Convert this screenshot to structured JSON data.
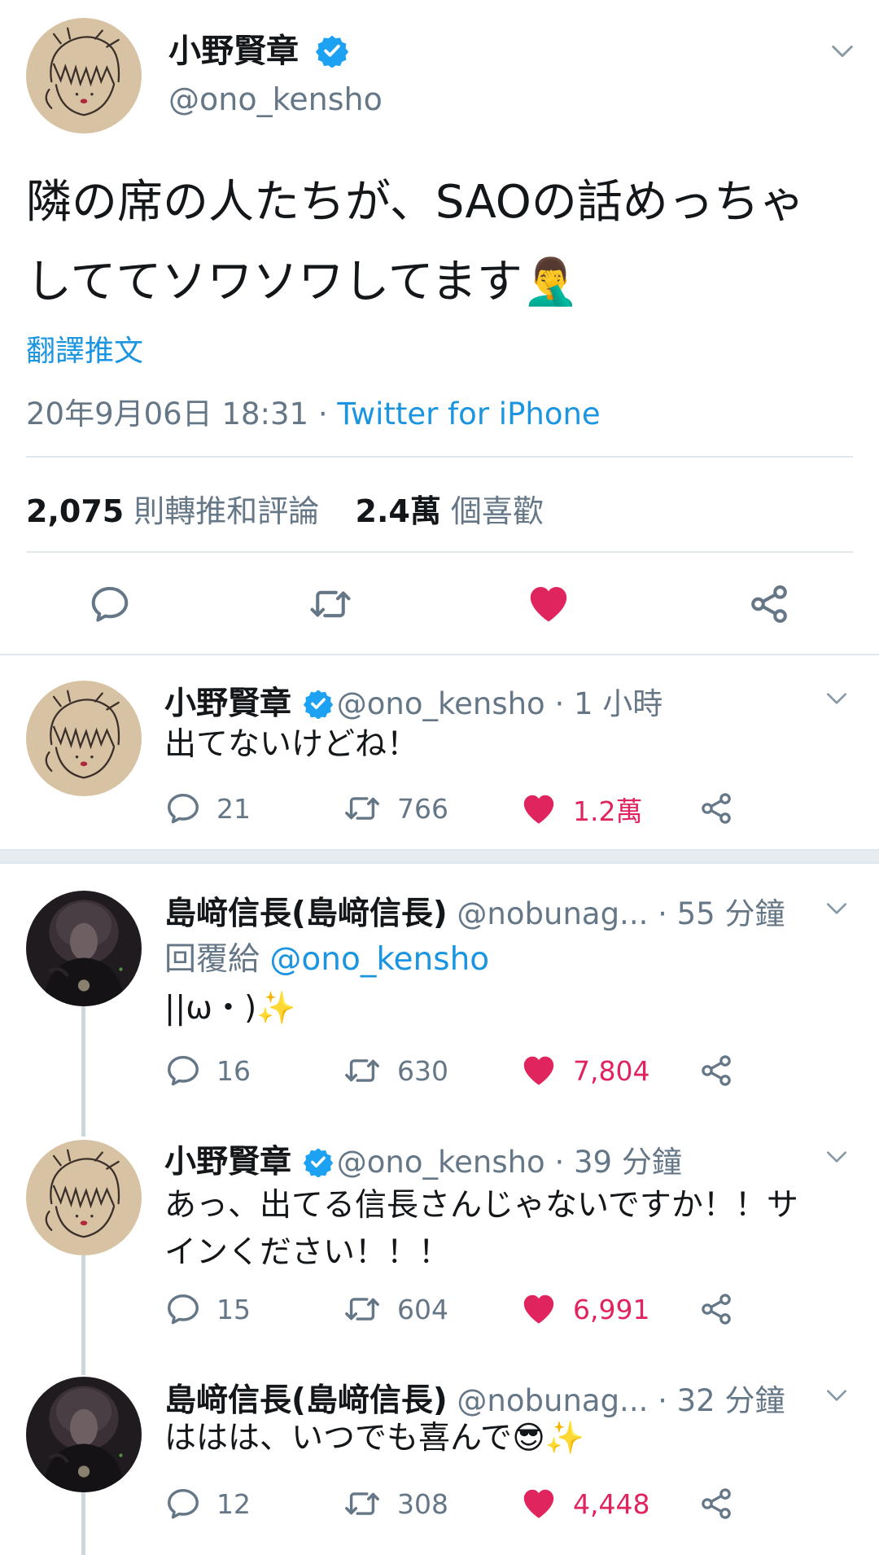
{
  "main_tweet": {
    "name": "小野賢章",
    "handle": "@ono_kensho",
    "text_line1": "隣の席の人たちが、SAOの話めっちゃ",
    "text_line2": "しててソワソワしてます",
    "emoji": "🤦‍♂️",
    "translate_label": "翻譯推文",
    "timestamp": "20年9月06日 18:31",
    "separator": " · ",
    "source": "Twitter for iPhone",
    "retweets_comments_count": "2,075",
    "retweets_comments_label": "則轉推和評論",
    "likes_count": "2.4萬",
    "likes_label": "個喜歡"
  },
  "replies": [
    {
      "name": "小野賢章",
      "verified": true,
      "handle": "@ono_kensho",
      "time": "· 1 小時",
      "text_lines": [
        "出てないけどね！"
      ],
      "replies": "21",
      "retweets": "766",
      "likes": "1.2萬"
    },
    {
      "name": "島﨑信長(島﨑信長)",
      "verified": false,
      "handle": "@nobunag...",
      "time": "· 55 分鐘",
      "reply_to_label": "回覆給",
      "reply_to_handle": "@ono_kensho",
      "text_lines": [
        "||ω・)"
      ],
      "emoji": "✨",
      "replies": "16",
      "retweets": "630",
      "likes": "7,804"
    },
    {
      "name": "小野賢章",
      "verified": true,
      "handle": "@ono_kensho",
      "time": "· 39 分鐘",
      "text_lines": [
        "あっ、出てる信長さんじゃないですか！！サ",
        "インください！！！"
      ],
      "replies": "15",
      "retweets": "604",
      "likes": "6,991"
    },
    {
      "name": "島﨑信長(島﨑信長)",
      "verified": false,
      "handle": "@nobunag...",
      "time": "· 32 分鐘",
      "text_lines": [
        "ははは、いつでも喜んで"
      ],
      "emoji": "😎✨",
      "replies": "12",
      "retweets": "308",
      "likes": "4,448"
    }
  ],
  "colors": {
    "text": "#14171a",
    "secondary": "#657786",
    "link": "#1b95e0",
    "like": "#e0245e",
    "divider": "#e1e8ed",
    "verified": "#1da1f2"
  },
  "icons": [
    "reply-icon",
    "retweet-icon",
    "heart-icon",
    "share-icon",
    "verified-badge-icon",
    "chevron-down-icon"
  ]
}
